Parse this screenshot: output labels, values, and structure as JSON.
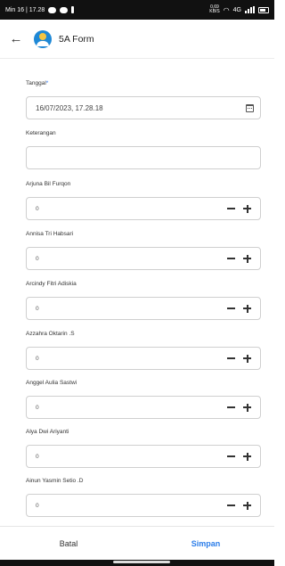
{
  "status_bar": {
    "time": "Min 16 | 17.28",
    "net_speed_top": "0,69",
    "net_speed_bottom": "KB/S",
    "network": "4G"
  },
  "app_bar": {
    "title": "5A Form"
  },
  "form": {
    "date_field": {
      "label": "Tanggal",
      "required_mark": "*",
      "value": "16/07/2023, 17.28.18"
    },
    "note_field": {
      "label": "Keterangan",
      "value": ""
    },
    "students": [
      {
        "name": "Arjuna Bil Furqon",
        "value": "0"
      },
      {
        "name": "Annisa Tri Habsari",
        "value": "0"
      },
      {
        "name": "Arcindy Fitri Adiskia",
        "value": "0"
      },
      {
        "name": "Azzahra Oktarin .S",
        "value": "0"
      },
      {
        "name": "Anggel Aulia Sastwi",
        "value": "0"
      },
      {
        "name": "Alya Dwi Ariyanti",
        "value": "0"
      },
      {
        "name": "Ainun Yasmin Setio .D",
        "value": "0"
      }
    ]
  },
  "actions": {
    "cancel_label": "Batal",
    "submit_label": "Simpan"
  },
  "colors": {
    "accent": "#2b7de9",
    "required": "#2979ff"
  }
}
